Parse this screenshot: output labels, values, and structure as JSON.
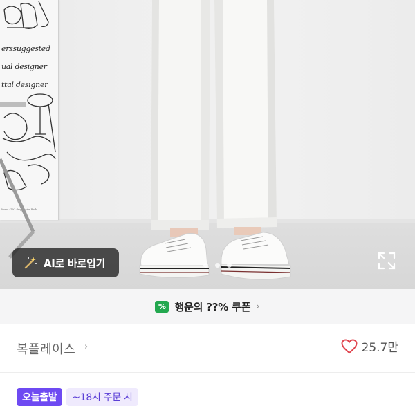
{
  "photo": {
    "poster_lines": [
      "erssuggested",
      "ual designer",
      "ttal designer"
    ],
    "poster_footnote": "Kaset · 150 · Impressive Birds",
    "ai_button_label": "AI로 바로입기",
    "ai_button_icon": "magic-wand-icon",
    "carousel_dot_count": 3,
    "expand_icon": "expand-icon"
  },
  "coupon": {
    "badge_symbol": "%",
    "label": "행운의 ??% 쿠폰",
    "chevron": "›",
    "colors": {
      "badge": "#23a84f"
    }
  },
  "store": {
    "name": "복플레이스",
    "chevron": "›",
    "likes_count": "25.7만",
    "like_icon": "heart-outline-icon",
    "colors": {
      "heart": "#e0454f"
    }
  },
  "delivery": {
    "today_label": "오늘출발",
    "cutoff_label": "~18시 주문 시",
    "colors": {
      "today_bg": "#6e4af2",
      "cutoff_bg": "#efeafd",
      "cutoff_text": "#5b3fd6"
    }
  }
}
